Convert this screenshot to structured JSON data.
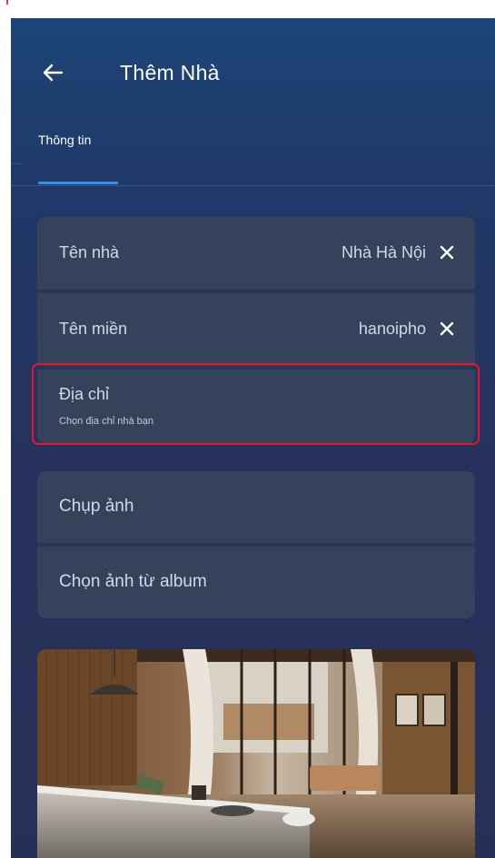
{
  "header": {
    "back_icon": "arrow-left-icon",
    "title": "Thêm Nhà"
  },
  "tabs": [
    {
      "label": "Thông tin",
      "active": true
    }
  ],
  "form": {
    "home_name": {
      "label": "Tên nhà",
      "value": "Nhà Hà Nội",
      "clear_icon": "close-icon"
    },
    "domain": {
      "label": "Tên miền",
      "value": "hanoipho",
      "clear_icon": "close-icon"
    },
    "address": {
      "label": "Địa chỉ",
      "hint": "Chọn địa chỉ nhà bạn"
    }
  },
  "photo_options": {
    "take_photo": "Chụp ảnh",
    "choose_album": "Chọn ảnh từ album"
  },
  "colors": {
    "background_top": "#1c4577",
    "background_bottom": "#282f57",
    "card": "#34435b",
    "accent": "#3d8fe8",
    "highlight": "#e5182a"
  }
}
